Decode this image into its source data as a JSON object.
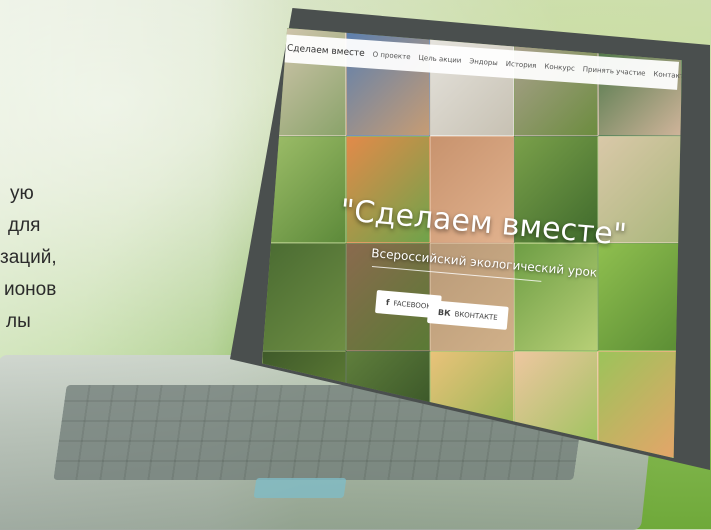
{
  "left_text": {
    "lines": [
      "ую",
      "",
      "для",
      "заций,",
      "ионов",
      "лы"
    ]
  },
  "site": {
    "brand": "Сделаем вместе",
    "nav": [
      "О проекте",
      "Цель акции",
      "Эндоры",
      "История",
      "Конкурс",
      "Принять участие",
      "Контакты"
    ],
    "hero_title": "\"Сделаем вместе\"",
    "hero_subtitle": "Всероссийский экологический урок",
    "share": {
      "facebook_label": "FACEBOOK",
      "facebook_icon": "facebook-icon",
      "vk_label": "ВКОНТАКТЕ",
      "vk_icon": "vk-icon"
    }
  }
}
